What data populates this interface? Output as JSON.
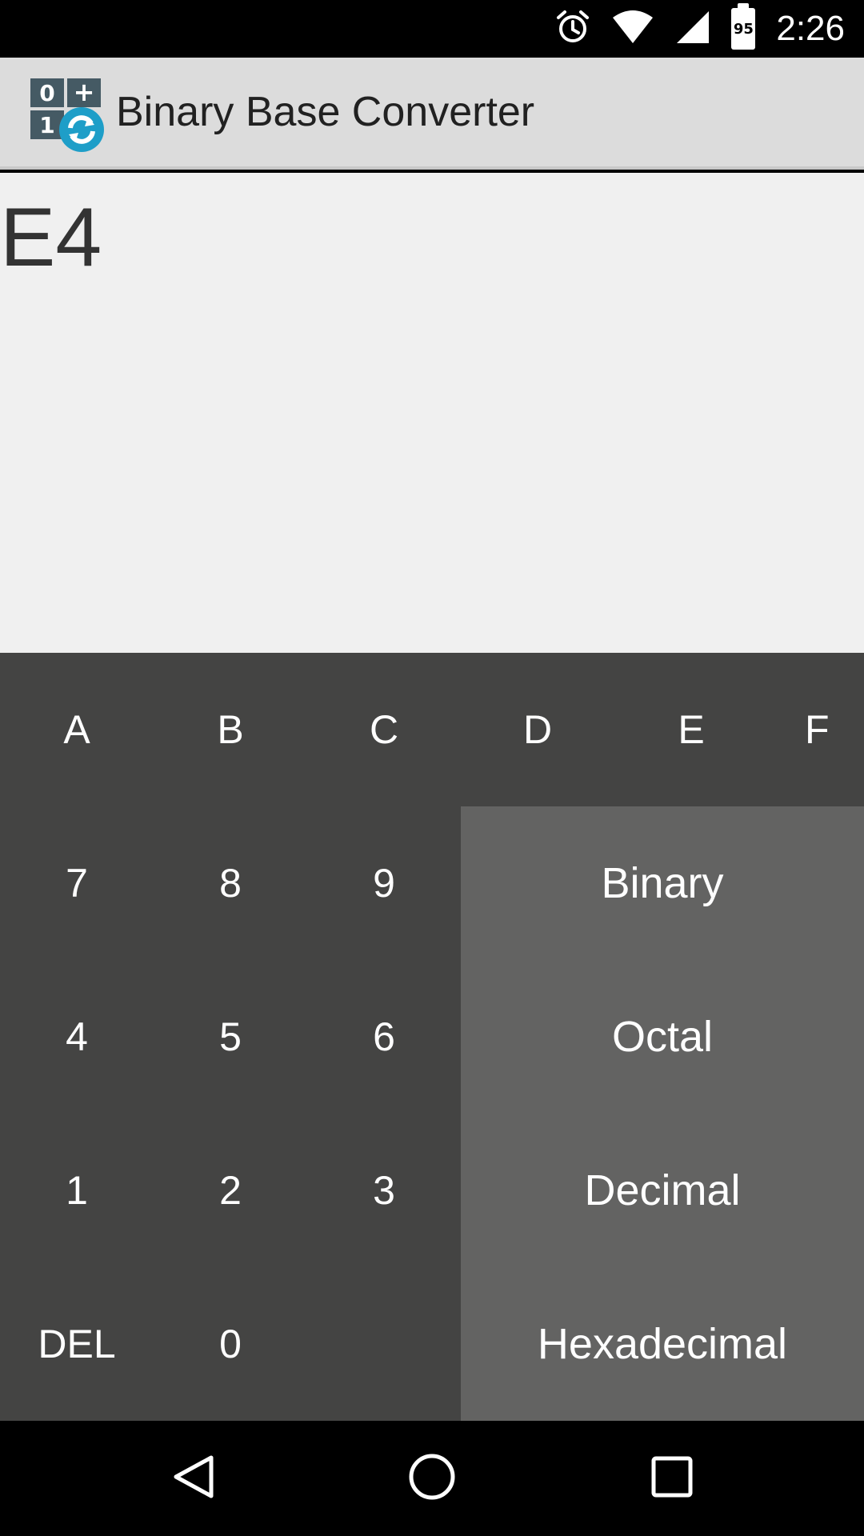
{
  "status_bar": {
    "time": "2:26",
    "battery_level": "95",
    "icons": [
      "alarm-icon",
      "wifi-icon",
      "signal-icon",
      "battery-icon"
    ]
  },
  "app_bar": {
    "title": "Binary Base Converter",
    "logo_icon": "binary-converter-logo-icon"
  },
  "display": {
    "value": "E4"
  },
  "keypad": {
    "hex_row": [
      "A",
      "B",
      "C",
      "D",
      "E",
      "F"
    ],
    "row_789": [
      "7",
      "8",
      "9"
    ],
    "row_456": [
      "4",
      "5",
      "6"
    ],
    "row_123": [
      "1",
      "2",
      "3"
    ],
    "row_del0": [
      "DEL",
      "0"
    ]
  },
  "conversions": [
    "Binary",
    "Octal",
    "Decimal",
    "Hexadecimal"
  ],
  "nav_bar": {
    "icons": [
      "back-icon",
      "home-icon",
      "recents-icon"
    ]
  },
  "colors": {
    "keypad_bg": "#444443",
    "conversion_bg": "#636362",
    "appbar_bg": "#dcdcdc",
    "display_bg": "#f0f0f0",
    "logo_accent": "#1e9ec8"
  }
}
